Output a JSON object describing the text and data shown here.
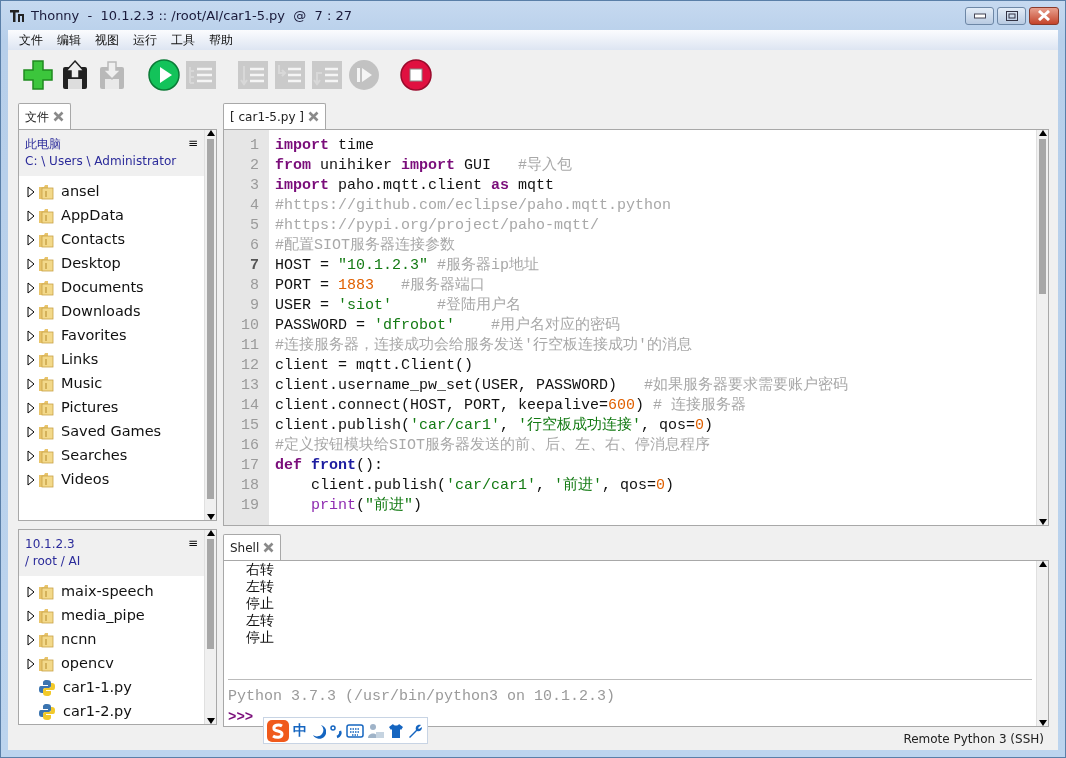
{
  "window": {
    "title": "Thonny  -  10.1.2.3 :: /root/AI/car1-5.py  @  7 : 27"
  },
  "menu": [
    "文件",
    "编辑",
    "视图",
    "运行",
    "工具",
    "帮助"
  ],
  "toolbar": [
    {
      "kind": "new",
      "disabled": false
    },
    {
      "kind": "save",
      "disabled": false
    },
    {
      "kind": "save_copy",
      "disabled": true
    },
    {
      "kind": "run",
      "disabled": false
    },
    {
      "kind": "debug",
      "disabled": true
    },
    {
      "kind": "step_over",
      "disabled": true
    },
    {
      "kind": "step_into",
      "disabled": true
    },
    {
      "kind": "step_out",
      "disabled": true
    },
    {
      "kind": "resume",
      "disabled": true
    },
    {
      "kind": "stop",
      "disabled": false
    }
  ],
  "files_tab": {
    "label": "文件"
  },
  "local_files": {
    "title": "此电脑",
    "path": "C: \\ Users \\ Administrator",
    "menu_glyph": "≡",
    "items": [
      {
        "name": "ansel",
        "kind": "folder"
      },
      {
        "name": "AppData",
        "kind": "folder"
      },
      {
        "name": "Contacts",
        "kind": "folder"
      },
      {
        "name": "Desktop",
        "kind": "folder"
      },
      {
        "name": "Documents",
        "kind": "folder"
      },
      {
        "name": "Downloads",
        "kind": "folder"
      },
      {
        "name": "Favorites",
        "kind": "folder"
      },
      {
        "name": "Links",
        "kind": "folder"
      },
      {
        "name": "Music",
        "kind": "folder"
      },
      {
        "name": "Pictures",
        "kind": "folder"
      },
      {
        "name": "Saved Games",
        "kind": "folder"
      },
      {
        "name": "Searches",
        "kind": "folder"
      },
      {
        "name": "Videos",
        "kind": "folder"
      }
    ]
  },
  "remote_files": {
    "title": "10.1.2.3",
    "path": "/ root / AI",
    "menu_glyph": "≡",
    "items": [
      {
        "name": "maix-speech",
        "kind": "folder"
      },
      {
        "name": "media_pipe",
        "kind": "folder"
      },
      {
        "name": "ncnn",
        "kind": "folder"
      },
      {
        "name": "opencv",
        "kind": "folder"
      },
      {
        "name": "car1-1.py",
        "kind": "file"
      },
      {
        "name": "car1-2.py",
        "kind": "file"
      }
    ]
  },
  "editor": {
    "tab": "[ car1-5.py ]",
    "lines": [
      {
        "number": "1",
        "current": false,
        "tokens": [
          {
            "kind": "keyword",
            "text": "import"
          },
          {
            "kind": "plain",
            "text": " time"
          }
        ]
      },
      {
        "number": "2",
        "current": false,
        "tokens": [
          {
            "kind": "keyword",
            "text": "from"
          },
          {
            "kind": "plain",
            "text": " unihiker "
          },
          {
            "kind": "keyword",
            "text": "import"
          },
          {
            "kind": "plain",
            "text": " GUI   "
          },
          {
            "kind": "comment",
            "text": "#导入包"
          }
        ]
      },
      {
        "number": "3",
        "current": false,
        "tokens": [
          {
            "kind": "keyword",
            "text": "import"
          },
          {
            "kind": "plain",
            "text": " paho.mqtt.client "
          },
          {
            "kind": "keyword",
            "text": "as"
          },
          {
            "kind": "plain",
            "text": " mqtt"
          }
        ]
      },
      {
        "number": "4",
        "current": false,
        "tokens": [
          {
            "kind": "comment",
            "text": "#https://github.com/eclipse/paho.mqtt.python"
          }
        ]
      },
      {
        "number": "5",
        "current": false,
        "tokens": [
          {
            "kind": "comment",
            "text": "#https://pypi.org/project/paho-mqtt/"
          }
        ]
      },
      {
        "number": "6",
        "current": false,
        "tokens": [
          {
            "kind": "comment",
            "text": "#配置SIOT服务器连接参数"
          }
        ]
      },
      {
        "number": "7",
        "current": true,
        "tokens": [
          {
            "kind": "plain",
            "text": "HOST = "
          },
          {
            "kind": "string",
            "text": "\"10.1.2.3\""
          },
          {
            "kind": "comment",
            "text": " #服务器ip地址"
          }
        ]
      },
      {
        "number": "8",
        "current": false,
        "tokens": [
          {
            "kind": "plain",
            "text": "PORT = "
          },
          {
            "kind": "number",
            "text": "1883"
          },
          {
            "kind": "comment",
            "text": "   #服务器端口"
          }
        ]
      },
      {
        "number": "9",
        "current": false,
        "tokens": [
          {
            "kind": "plain",
            "text": "USER = "
          },
          {
            "kind": "string",
            "text": "'siot'"
          },
          {
            "kind": "comment",
            "text": "     #登陆用户名"
          }
        ]
      },
      {
        "number": "10",
        "current": false,
        "tokens": [
          {
            "kind": "plain",
            "text": "PASSWORD = "
          },
          {
            "kind": "string",
            "text": "'dfrobot'"
          },
          {
            "kind": "comment",
            "text": "    #用户名对应的密码"
          }
        ]
      },
      {
        "number": "11",
        "current": false,
        "tokens": [
          {
            "kind": "comment",
            "text": "#连接服务器，连接成功会给服务发送'行空板连接成功'的消息"
          }
        ]
      },
      {
        "number": "12",
        "current": false,
        "tokens": [
          {
            "kind": "plain",
            "text": "client = mqtt.Client()"
          }
        ]
      },
      {
        "number": "13",
        "current": false,
        "tokens": [
          {
            "kind": "plain",
            "text": "client.username_pw_set(USER, PASSWORD)   "
          },
          {
            "kind": "comment",
            "text": "#如果服务器要求需要账户密码"
          }
        ]
      },
      {
        "number": "14",
        "current": false,
        "tokens": [
          {
            "kind": "plain",
            "text": "client.connect(HOST, PORT, keepalive="
          },
          {
            "kind": "number",
            "text": "600"
          },
          {
            "kind": "plain",
            "text": ") "
          },
          {
            "kind": "comment",
            "text": "# 连接服务器"
          }
        ]
      },
      {
        "number": "15",
        "current": false,
        "tokens": [
          {
            "kind": "plain",
            "text": "client.publish("
          },
          {
            "kind": "string",
            "text": "'car/car1'"
          },
          {
            "kind": "plain",
            "text": ", "
          },
          {
            "kind": "string",
            "text": "'行空板成功连接'"
          },
          {
            "kind": "plain",
            "text": ", qos="
          },
          {
            "kind": "number",
            "text": "0"
          },
          {
            "kind": "plain",
            "text": ")"
          }
        ]
      },
      {
        "number": "16",
        "current": false,
        "tokens": [
          {
            "kind": "comment",
            "text": "#定义按钮模块给SIOT服务器发送的前、后、左、右、停消息程序"
          }
        ]
      },
      {
        "number": "17",
        "current": false,
        "tokens": [
          {
            "kind": "keyword",
            "text": "def"
          },
          {
            "kind": "defname",
            "text": " front"
          },
          {
            "kind": "plain",
            "text": "():"
          }
        ]
      },
      {
        "number": "18",
        "current": false,
        "tokens": [
          {
            "kind": "plain",
            "text": "    client.publish("
          },
          {
            "kind": "string",
            "text": "'car/car1'"
          },
          {
            "kind": "plain",
            "text": ", "
          },
          {
            "kind": "string",
            "text": "'前进'"
          },
          {
            "kind": "plain",
            "text": ", qos="
          },
          {
            "kind": "number",
            "text": "0"
          },
          {
            "kind": "plain",
            "text": ")"
          }
        ]
      },
      {
        "number": "19",
        "current": false,
        "tokens": [
          {
            "kind": "builtin",
            "text": "    print"
          },
          {
            "kind": "plain",
            "text": "("
          },
          {
            "kind": "string",
            "text": "\"前进\""
          },
          {
            "kind": "plain",
            "text": ")"
          }
        ]
      }
    ]
  },
  "shell": {
    "tab": "Shell",
    "output": [
      "右转",
      "左转",
      "停止",
      "左转",
      "停止"
    ],
    "banner": "Python 3.7.3 (/usr/bin/python3 on 10.1.2.3)",
    "prompt": ">>>"
  },
  "ime_bar": {
    "mode": "中"
  },
  "status_bar": "Remote Python 3 (SSH)"
}
